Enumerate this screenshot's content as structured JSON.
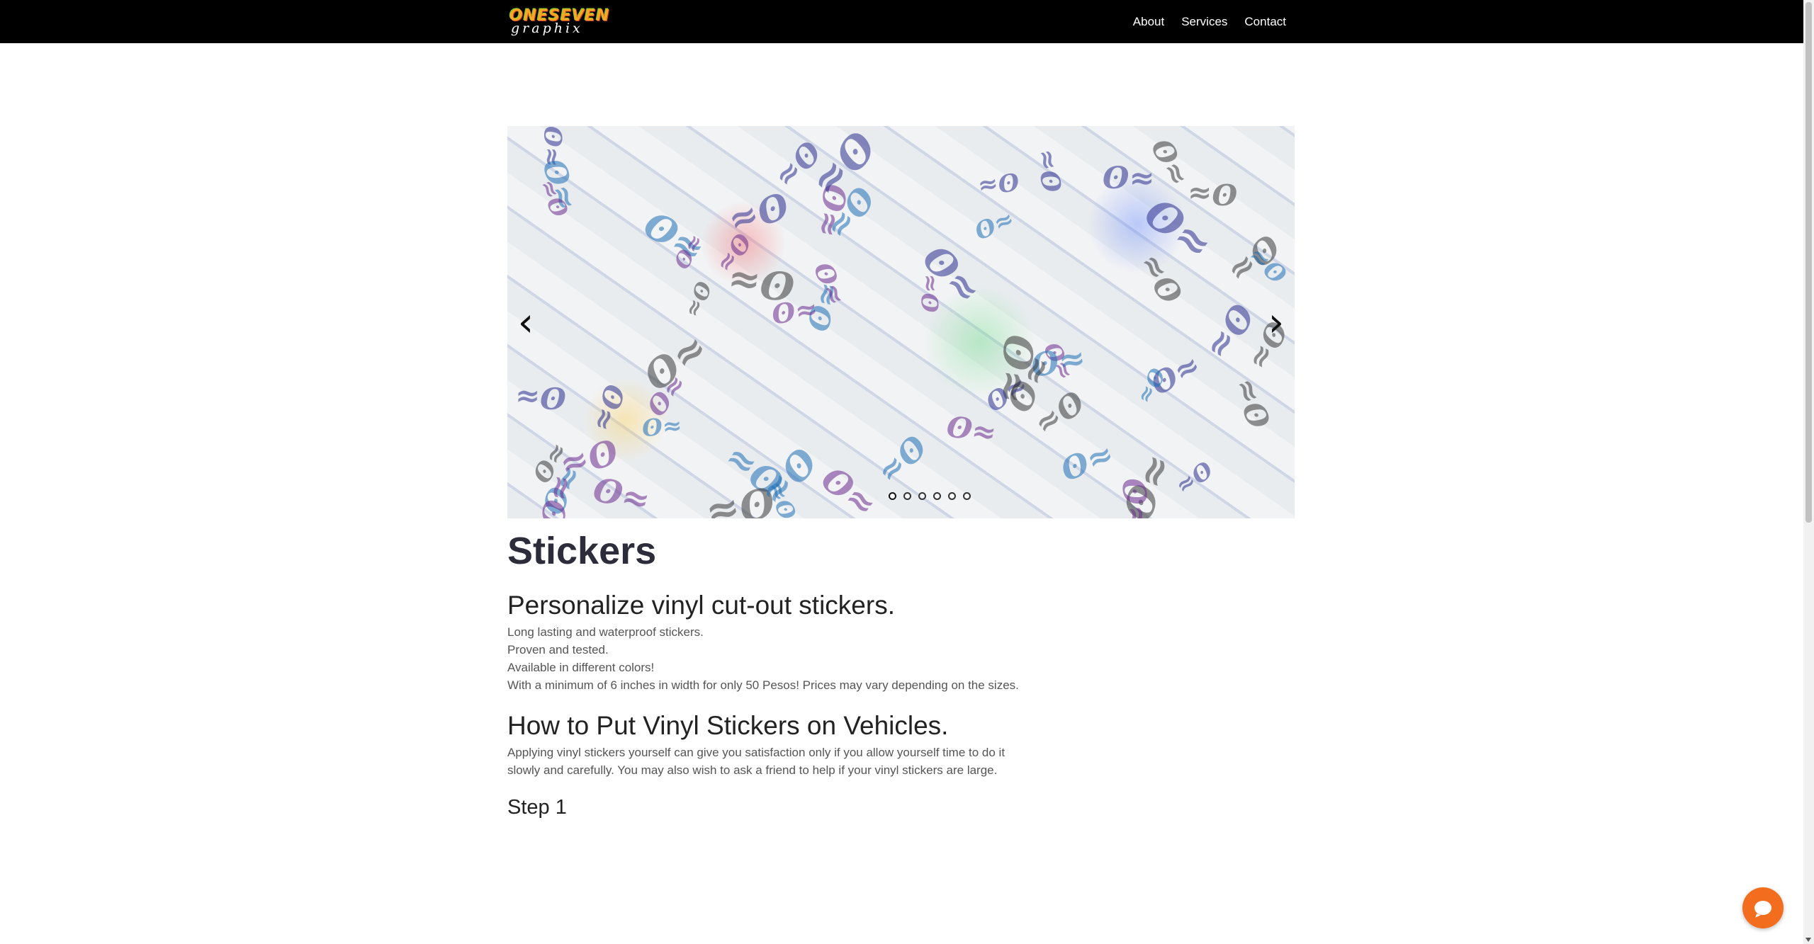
{
  "header": {
    "logo_top": "ONESEVEN",
    "logo_bottom": "graphix",
    "nav": [
      "About",
      "Services",
      "Contact"
    ]
  },
  "slider": {
    "prev_icon": "‹",
    "next_icon": "›",
    "slide_count": 6,
    "active_index": 0
  },
  "content": {
    "title": "Stickers",
    "subtitle": "Personalize vinyl cut-out stickers.",
    "p1": "Long lasting and waterproof stickers.",
    "p2": "Proven and tested.",
    "p3": "Available in different colors!",
    "p4": "With a minimum of 6 inches in width for only 50 Pesos! Prices may vary depending on the sizes.",
    "heading2": "How to Put Vinyl Stickers on Vehicles.",
    "p5": "Applying vinyl stickers yourself can give you satisfaction only if you allow yourself time to do it slowly and carefully. You may also wish to ask a friend to help if your vinyl stickers are large.",
    "step1": "Step 1"
  },
  "colors": {
    "header_bg": "#000000",
    "chat_button": "#f26d1d",
    "logo_orange": "#f5a623",
    "logo_green": "#7fd321"
  },
  "icons": {
    "chat": "chat-icon",
    "prev": "chevron-left-icon",
    "next": "chevron-right-icon"
  }
}
